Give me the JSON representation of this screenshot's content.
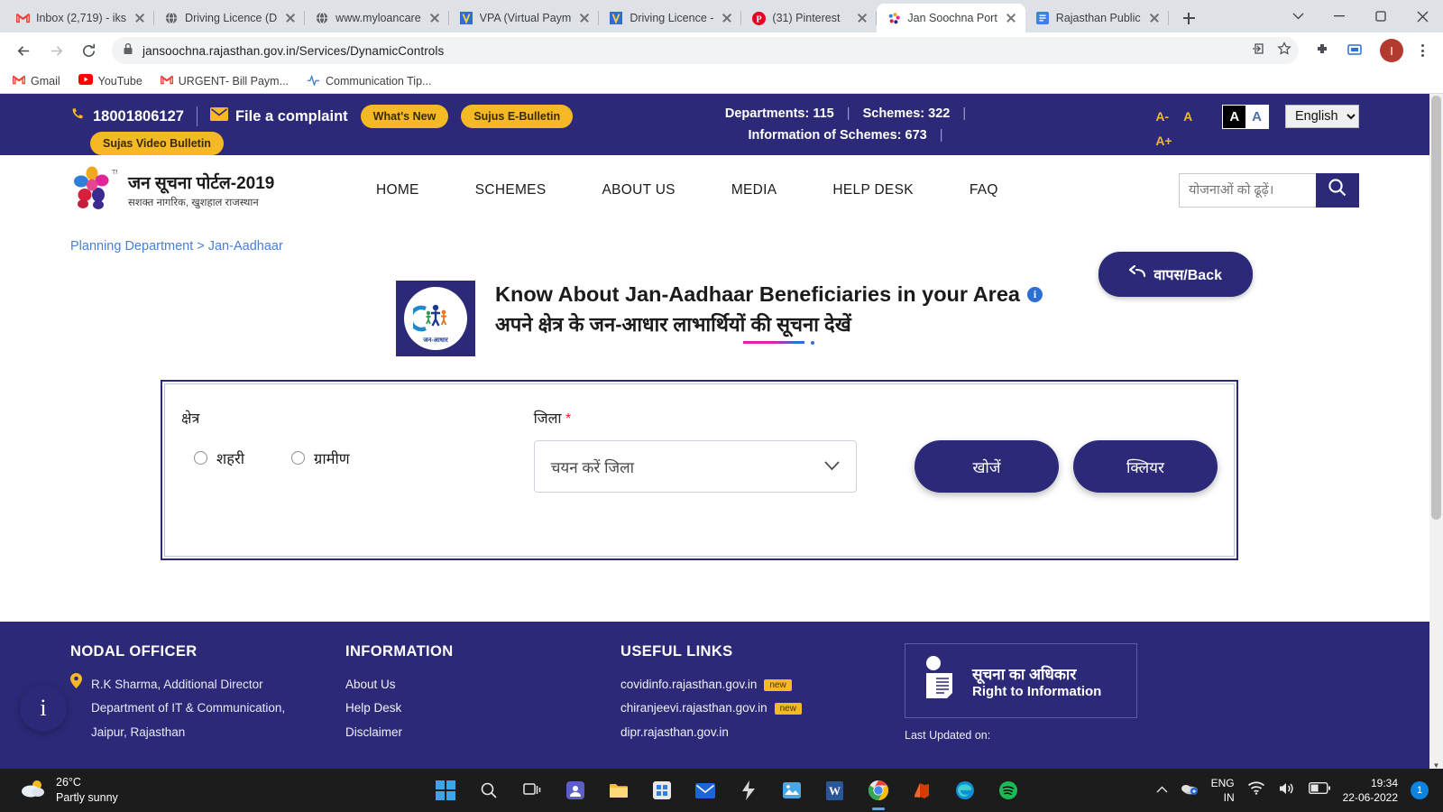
{
  "browser": {
    "tabs": [
      {
        "title": "Inbox (2,719) - iks",
        "favicon": "gmail-icon",
        "active": false
      },
      {
        "title": "Driving Licence (D",
        "favicon": "globe-icon",
        "active": false
      },
      {
        "title": "www.myloancare",
        "favicon": "globe-icon",
        "active": false
      },
      {
        "title": "VPA (Virtual Paym",
        "favicon": "vpa-icon",
        "active": false
      },
      {
        "title": "Driving Licence -",
        "favicon": "vpa-icon",
        "active": false
      },
      {
        "title": "(31) Pinterest",
        "favicon": "pinterest-icon",
        "active": false
      },
      {
        "title": "Jan Soochna Port",
        "favicon": "jansoochna-icon",
        "active": true
      },
      {
        "title": "Rajasthan Public",
        "favicon": "doc-icon",
        "active": false
      }
    ],
    "url": "jansoochna.rajasthan.gov.in/Services/DynamicControls",
    "profile_initial": "I",
    "bookmarks": [
      {
        "label": "Gmail",
        "icon": "gmail-icon"
      },
      {
        "label": "YouTube",
        "icon": "youtube-icon"
      },
      {
        "label": "URGENT- Bill Paym...",
        "icon": "gmail-icon"
      },
      {
        "label": "Communication Tip...",
        "icon": "pulse-icon"
      }
    ]
  },
  "topbar": {
    "phone": "18001806127",
    "complaint": "File a complaint",
    "whats_new": "What's New",
    "e_bulletin": "Sujus E-Bulletin",
    "video_bulletin": "Sujas Video Bulletin",
    "departments": "Departments: 115",
    "schemes": "Schemes: 322",
    "info_schemes": "Information of Schemes: 673",
    "font_minus": "A-",
    "font_normal": "A",
    "font_plus": "A+",
    "contrast_dark": "A",
    "contrast_light": "A",
    "language": "English",
    "accent": "#f5b925",
    "bg": "#2c2a78"
  },
  "header": {
    "brand_title": "जन सूचना पोर्टल-2019",
    "brand_subtitle": "सशक्त नागरिक, खुशहाल राजस्थान",
    "nav": [
      "HOME",
      "SCHEMES",
      "ABOUT US",
      "MEDIA",
      "HELP DESK",
      "FAQ"
    ],
    "search_placeholder": "योजनाओं को ढूढ़ें।"
  },
  "main": {
    "breadcrumb": "Planning Department > Jan-Aadhaar",
    "back_button": "वापस/Back",
    "service_logo_label": "जन-आधार",
    "title_en": "Know About Jan-Aadhaar Beneficiaries in your Area",
    "title_hi": "अपने क्षेत्र के जन-आधार लाभार्थियों की सूचना देखें",
    "form": {
      "area_label": "क्षेत्र",
      "radio_urban": "शहरी",
      "radio_rural": "ग्रामीण",
      "district_label": "जिला",
      "district_required": "*",
      "district_value": "चयन करें जिला",
      "search_button": "खोजें",
      "clear_button": "क्लियर"
    }
  },
  "footer": {
    "nodal_heading": "NODAL OFFICER",
    "nodal_lines": [
      "R.K Sharma, Additional Director",
      "Department of IT & Communication,",
      "Jaipur, Rajasthan"
    ],
    "information_heading": "INFORMATION",
    "information_links": [
      "About Us",
      "Help Desk",
      "Disclaimer"
    ],
    "useful_heading": "USEFUL LINKS",
    "useful_links": [
      {
        "label": "covidinfo.rajasthan.gov.in",
        "badge": "new"
      },
      {
        "label": "chiranjeevi.rajasthan.gov.in",
        "badge": "new"
      },
      {
        "label": "dipr.rajasthan.gov.in",
        "badge": ""
      }
    ],
    "rti_hi": "सूचना का अधिकार",
    "rti_en": "Right to Information",
    "last_updated": "Last Updated on:"
  },
  "taskbar": {
    "temperature": "26°C",
    "condition": "Partly sunny",
    "language": "ENG",
    "region": "IN",
    "time": "19:34",
    "date": "22-06-2022",
    "notification_count": "1"
  }
}
